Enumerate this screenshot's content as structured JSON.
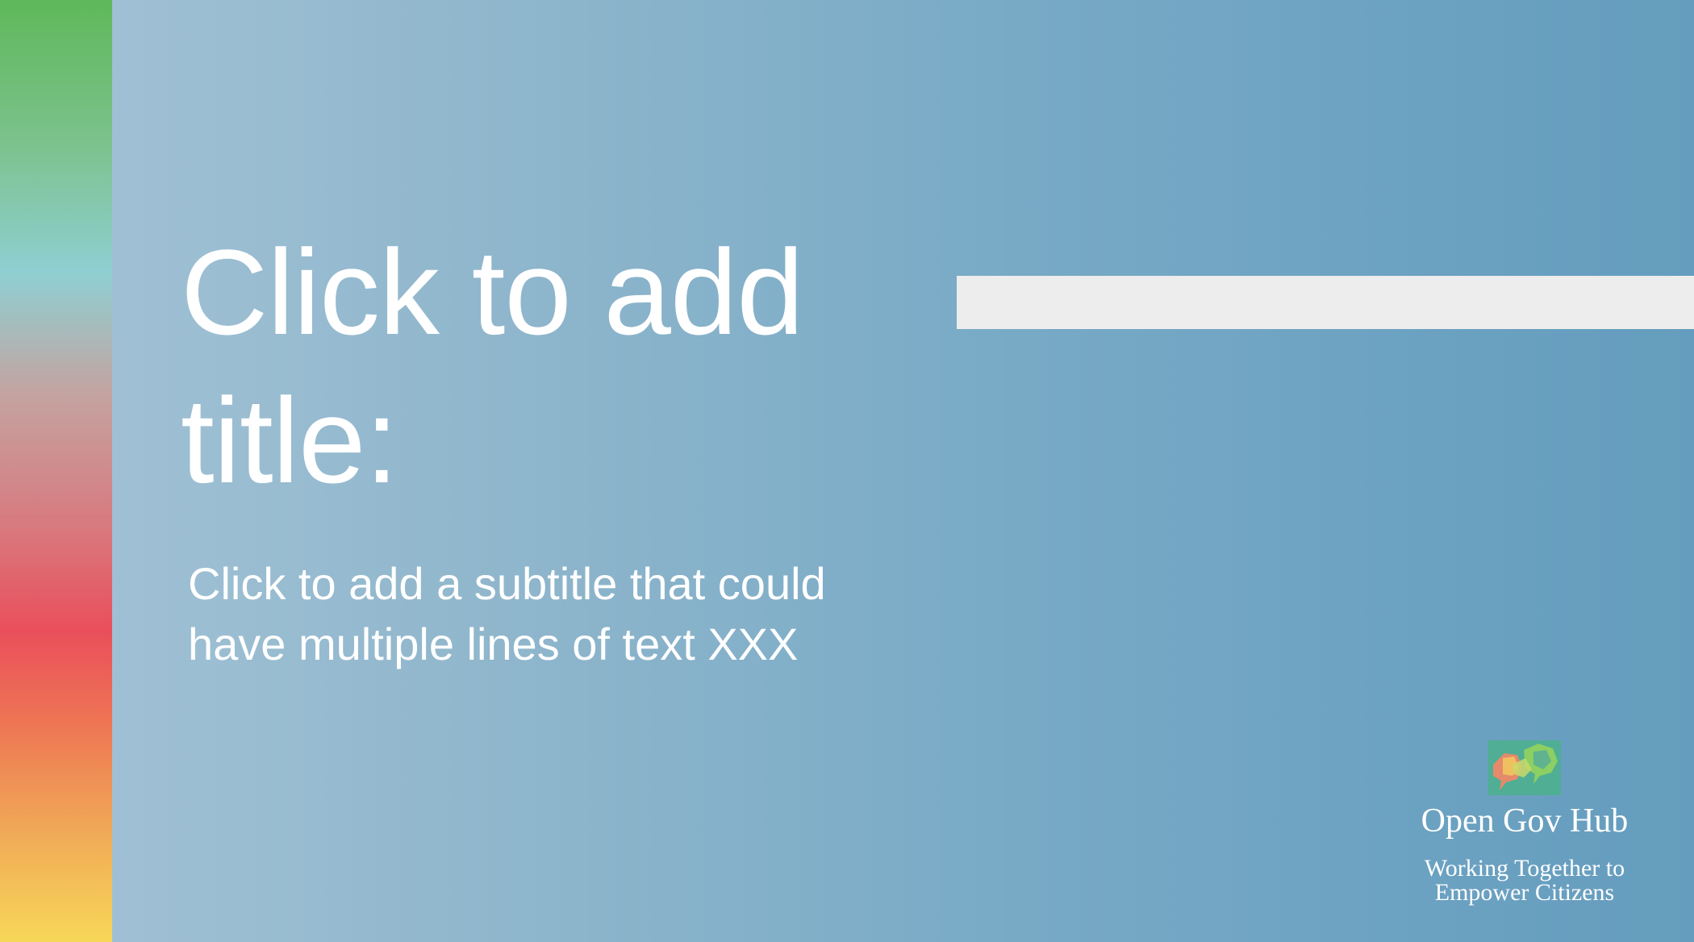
{
  "slide": {
    "title": "Click to add title:",
    "subtitle": "Click to add a subtitle that could have multiple lines of text XXX"
  },
  "logo": {
    "name": "Open Gov Hub",
    "tagline_line1": "Working Together to",
    "tagline_line2": "Empower Citizens",
    "icon": "speech-bubbles-icon"
  },
  "colors": {
    "background_left": "#a4c3d6",
    "background_right": "#659dbe",
    "accent_bar": "#ededed",
    "strip_green": "#5fb85a",
    "strip_teal": "#8fcfd2",
    "strip_red": "#ea4f5b",
    "strip_yellow": "#f7d758"
  }
}
